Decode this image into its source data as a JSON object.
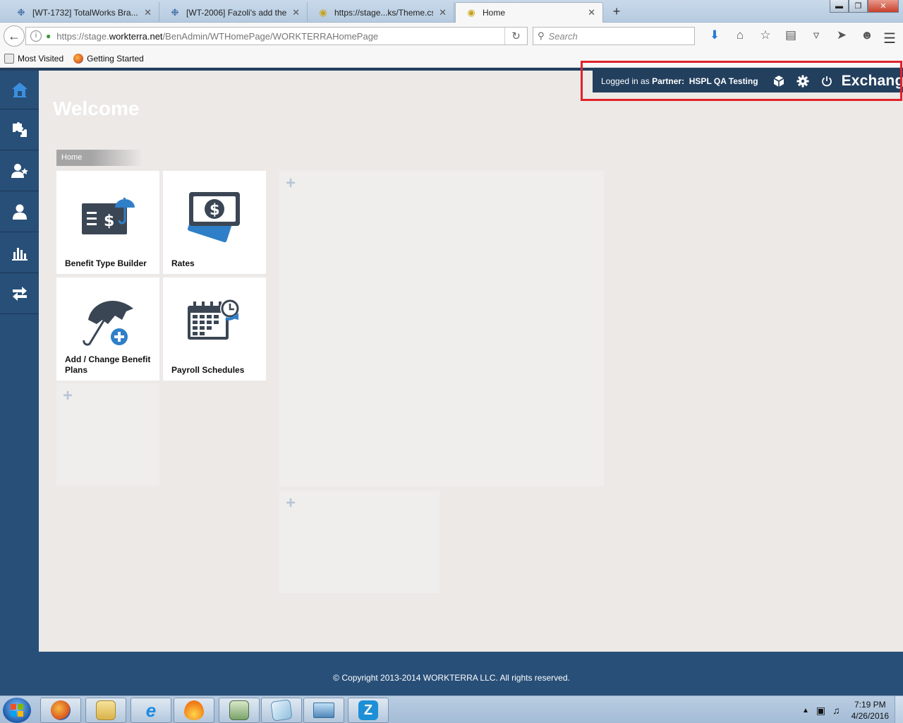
{
  "browser": {
    "tabs": [
      {
        "label": "[WT-1732] TotalWorks Bra...",
        "icon": "jira-icon",
        "active": false
      },
      {
        "label": "[WT-2006] Fazoli's add the...",
        "icon": "jira-icon",
        "active": false
      },
      {
        "label": "https://stage...ks/Theme.css",
        "icon": "css-icon",
        "active": false
      },
      {
        "label": "Home",
        "icon": "page-icon",
        "active": true
      }
    ],
    "url_prefix": "https://stage.",
    "url_domain": "workterra.net",
    "url_path": "/BenAdmin/WTHomePage/WORKTERRAHomePage",
    "search_placeholder": "Search",
    "bookmarks": [
      {
        "label": "Most Visited"
      },
      {
        "label": "Getting Started"
      }
    ]
  },
  "header": {
    "logged_prefix": "Logged in as",
    "role": "Partner:",
    "user": "HSPL QA Testing",
    "brand": "Exchange"
  },
  "page": {
    "title": "Welcome",
    "breadcrumb": "Home"
  },
  "sidebar": {
    "items": [
      {
        "icon": "home-icon"
      },
      {
        "icon": "puzzle-icon"
      },
      {
        "icon": "user-star-icon"
      },
      {
        "icon": "user-icon"
      },
      {
        "icon": "bar-chart-icon"
      },
      {
        "icon": "transfer-icon"
      }
    ]
  },
  "tiles": [
    {
      "label": "Benefit Type Builder",
      "icon": "benefit-check-icon"
    },
    {
      "label": "Rates",
      "icon": "dollar-bill-icon"
    },
    {
      "label": "Add / Change Benefit Plans",
      "icon": "umbrella-add-icon"
    },
    {
      "label": "Payroll Schedules",
      "icon": "calendar-clock-icon"
    }
  ],
  "footer": {
    "copyright": "© Copyright 2013-2014 WORKTERRA LLC. All rights reserved."
  },
  "taskbar": {
    "time": "7:19 PM",
    "date": "4/26/2016",
    "zapp": "Z"
  },
  "colors": {
    "navy": "#284f78",
    "dark_navy": "#233f5e",
    "highlight_red": "#e0222b",
    "tile_blue": "#2f7fc8",
    "icon_dark": "#3b4654"
  }
}
